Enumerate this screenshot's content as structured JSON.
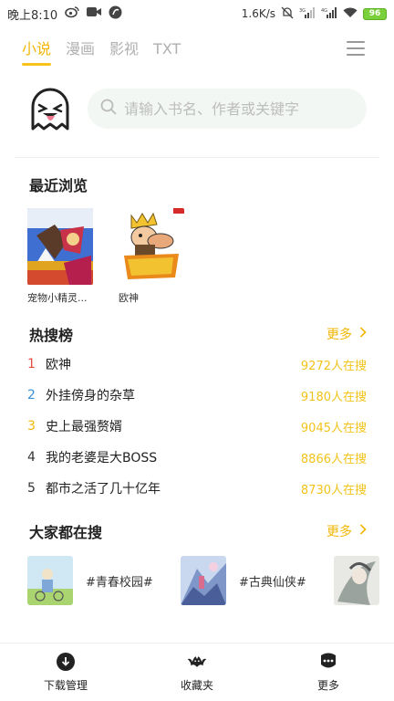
{
  "status_bar": {
    "time": "晚上8:10",
    "speed": "1.6K/s",
    "battery": "96"
  },
  "tabs": [
    {
      "label": "小说",
      "active": true
    },
    {
      "label": "漫画",
      "active": false
    },
    {
      "label": "影视",
      "active": false
    },
    {
      "label": "TXT",
      "active": false
    }
  ],
  "search": {
    "placeholder": "请输入书名、作者或关键字"
  },
  "recent": {
    "title": "最近浏览",
    "books": [
      {
        "title": "宠物小精灵..."
      },
      {
        "title": "欧神"
      }
    ]
  },
  "hot": {
    "title": "热搜榜",
    "more": "更多",
    "items": [
      {
        "rank": "1",
        "name": "欧神",
        "count": "9272人在搜",
        "rank_color": "#e94b3c"
      },
      {
        "rank": "2",
        "name": "外挂傍身的杂草",
        "count": "9180人在搜",
        "rank_color": "#3a8fd9"
      },
      {
        "rank": "3",
        "name": "史上最强赘婿",
        "count": "9045人在搜",
        "rank_color": "#f2b705"
      },
      {
        "rank": "4",
        "name": "我的老婆是大BOSS",
        "count": "8866人在搜",
        "rank_color": "#333333"
      },
      {
        "rank": "5",
        "name": "都市之活了几十亿年",
        "count": "8730人在搜",
        "rank_color": "#333333"
      }
    ]
  },
  "topics": {
    "title": "大家都在搜",
    "more": "更多",
    "items": [
      {
        "label": "#青春校园#"
      },
      {
        "label": "#古典仙侠#"
      }
    ]
  },
  "bottom_nav": [
    {
      "label": "下载管理",
      "icon": "download-icon"
    },
    {
      "label": "收藏夹",
      "icon": "bat-icon"
    },
    {
      "label": "更多",
      "icon": "more-dots-icon"
    }
  ],
  "colors": {
    "accent": "#f2b705",
    "accent_light": "#f7c31a"
  }
}
